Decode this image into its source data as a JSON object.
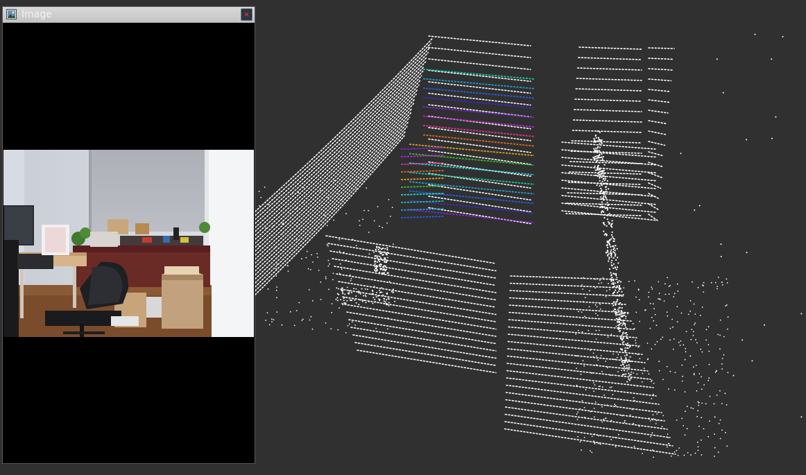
{
  "image_window": {
    "title": "Image",
    "close_glyph": "×",
    "icon": "image-icon"
  },
  "colors": {
    "viewport_background": "#303030",
    "panel_background": "#000000",
    "point_color": "#ffffff",
    "close_color": "#e0413a"
  }
}
